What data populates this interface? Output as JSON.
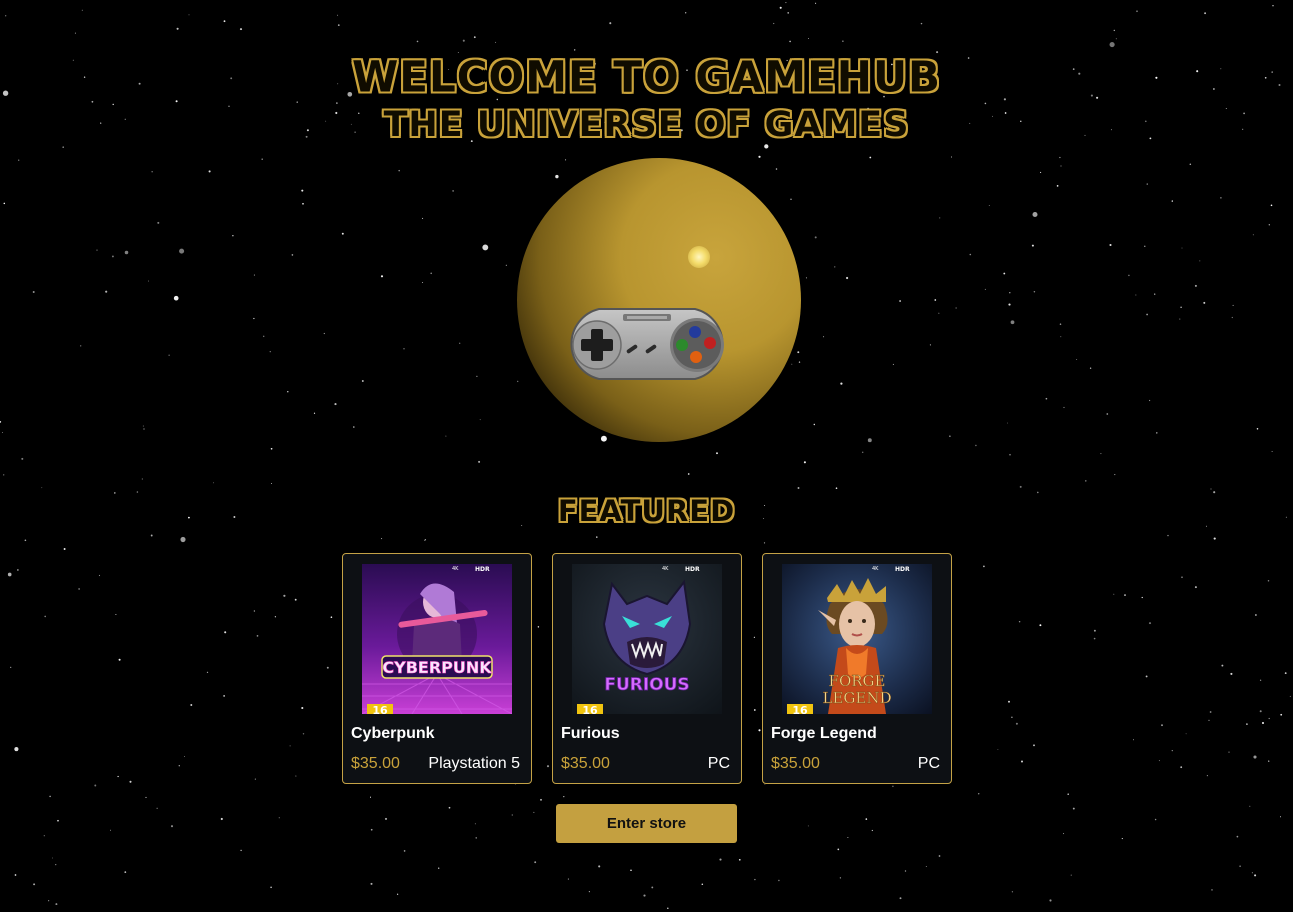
{
  "hero": {
    "title": "WELCOME TO GAMEHUB",
    "subtitle": "THE UNIVERSE OF GAMES"
  },
  "featured": {
    "title": "FEATURED",
    "games": [
      {
        "name": "Cyberpunk",
        "price": "$35.00",
        "platform": "Playstation 5",
        "cover_text": "CYBERPUNK",
        "age_rating": "16",
        "badge": "HDR",
        "badge_small": "4K"
      },
      {
        "name": "Furious",
        "price": "$35.00",
        "platform": "PC",
        "cover_text": "FURIOUS",
        "age_rating": "16",
        "badge": "HDR",
        "badge_small": "4K"
      },
      {
        "name": "Forge Legend",
        "price": "$35.00",
        "platform": "PC",
        "cover_text_1": "FORGE",
        "cover_text_2": "LEGEND",
        "age_rating": "16",
        "badge": "HDR",
        "badge_small": "4K"
      }
    ]
  },
  "store": {
    "enter_label": "Enter store"
  },
  "colors": {
    "accent": "#c4a040",
    "background": "#000000",
    "card_bg": "#0d1014"
  },
  "icons": {
    "hero_image": "snes-controller-icon",
    "planet": "planet"
  }
}
